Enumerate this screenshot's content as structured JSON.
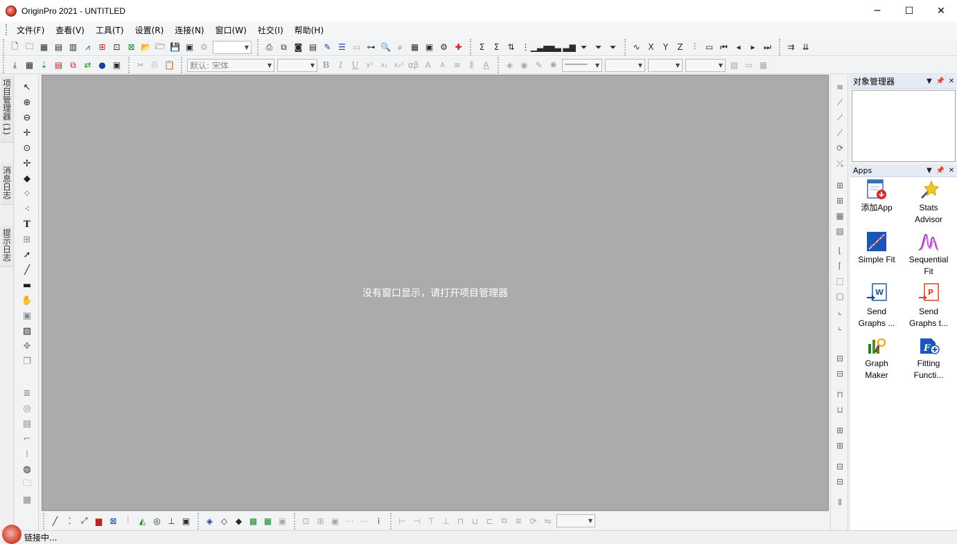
{
  "window": {
    "title": "OriginPro 2021 - UNTITLED",
    "minimize": "─",
    "maximize": "☐",
    "close": "✕"
  },
  "menu": [
    "文件(F)",
    "查看(V)",
    "工具(T)",
    "设置(R)",
    "连接(N)",
    "窗口(W)",
    "社交(I)",
    "帮助(H)"
  ],
  "toolbar": {
    "font_name": "默认: 宋体",
    "bold": "B",
    "italic": "I",
    "underline": "U",
    "superscript": "x²",
    "subscript": "x₂",
    "super_sub": "x₂²",
    "greek": "αβ",
    "increase_font": "A",
    "decrease_font": "A",
    "font_color": "A",
    "line_style": "──────"
  },
  "left_tabs": [
    "项目管理器 (1)",
    "消息日志",
    "提示日志"
  ],
  "workspace": {
    "message": "没有窗口显示，请打开项目管理器"
  },
  "panels": {
    "object_manager": {
      "title": "对象管理器"
    },
    "apps": {
      "title": "Apps",
      "items": [
        {
          "line1": "添加App",
          "line2": "",
          "icon": "add-app-icon"
        },
        {
          "line1": "Stats",
          "line2": "Advisor",
          "icon": "stats-advisor-icon"
        },
        {
          "line1": "Simple Fit",
          "line2": "",
          "icon": "simple-fit-icon"
        },
        {
          "line1": "Sequential",
          "line2": "Fit",
          "icon": "sequential-fit-icon"
        },
        {
          "line1": "Send",
          "line2": "Graphs ...",
          "icon": "send-graphs-word-icon"
        },
        {
          "line1": "Send",
          "line2": "Graphs t...",
          "icon": "send-graphs-ppt-icon"
        },
        {
          "line1": "Graph",
          "line2": "Maker",
          "icon": "graph-maker-icon"
        },
        {
          "line1": "Fitting",
          "line2": "Functi...",
          "icon": "fitting-function-icon"
        }
      ]
    }
  },
  "status": {
    "text": "链接中..."
  },
  "colors": {
    "workspace_bg": "#ababab",
    "panel_header": "#e4ebf5",
    "accent_red": "#d3402b"
  }
}
